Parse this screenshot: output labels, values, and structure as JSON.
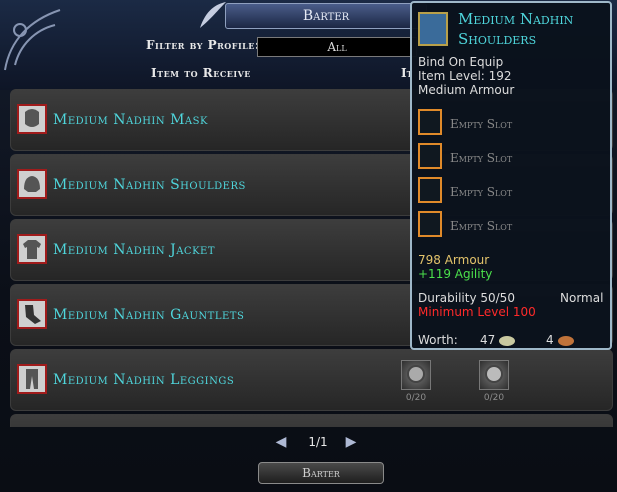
{
  "title": "Barter",
  "filter": {
    "label": "Filter by Profile:",
    "value": "All"
  },
  "columns": {
    "receive": "Item to Receive",
    "cost": "It"
  },
  "rows": [
    {
      "name": "Medium Nadhin Mask",
      "icon": "mask-icon",
      "costs": []
    },
    {
      "name": "Medium Nadhin Shoulders",
      "icon": "shoulders-icon",
      "costs": []
    },
    {
      "name": "Medium Nadhin Jacket",
      "icon": "jacket-icon",
      "costs": []
    },
    {
      "name": "Medium Nadhin Gauntlets",
      "icon": "gauntlets-icon",
      "costs": []
    },
    {
      "name": "Medium Nadhin Leggings",
      "icon": "leggings-icon",
      "costs": [
        {
          "count": "0/20"
        },
        {
          "count": "0/20"
        }
      ]
    }
  ],
  "pager": {
    "page": "1/1",
    "prev_icon": "left-arrow-icon",
    "next_icon": "right-arrow-icon"
  },
  "button": {
    "label": "Barter"
  },
  "tooltip": {
    "title": "Medium Nadhin Shoulders",
    "bind": "Bind On Equip",
    "item_level": "Item Level: 192",
    "type": "Medium Armour",
    "slots": [
      "Empty Slot",
      "Empty Slot",
      "Empty Slot",
      "Empty Slot"
    ],
    "armour": "798 Armour",
    "agility": "+119 Agility",
    "durability": "Durability 50/50",
    "quality": "Normal",
    "min_level": "Minimum Level 100",
    "worth_label": "Worth:",
    "worth_silver": "47",
    "worth_copper": "4",
    "colors": {
      "title": "#4fd6dc",
      "stat": "#e3c36b",
      "bonus": "#4be04b",
      "warning": "#ff2a2a",
      "slot_border": "#e08a2a"
    }
  }
}
